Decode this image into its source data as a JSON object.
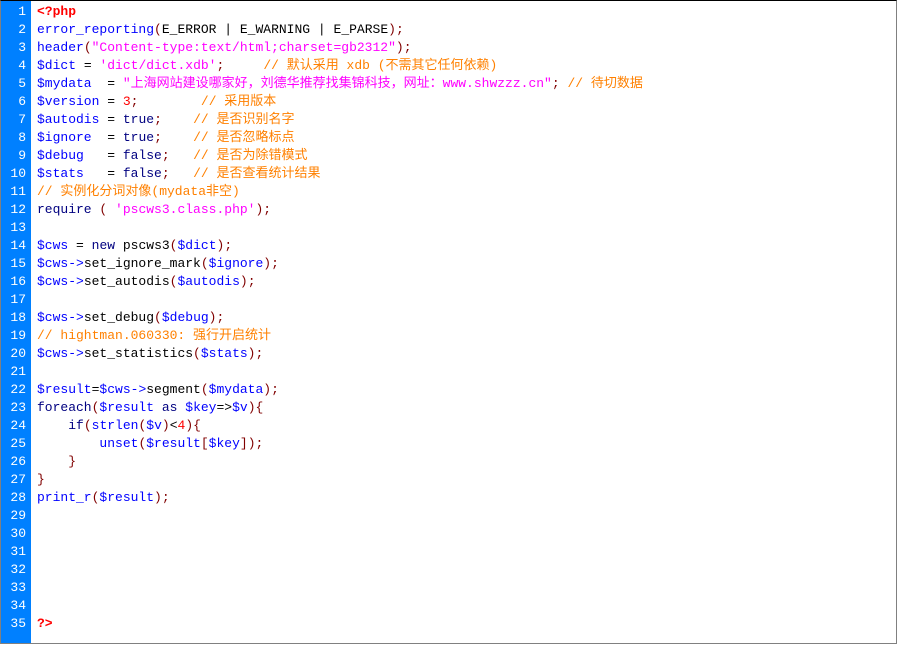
{
  "lines": [
    {
      "n": 1,
      "tokens": [
        [
          "php-tag",
          "<?php"
        ]
      ]
    },
    {
      "n": 2,
      "tokens": [
        [
          "func",
          "error_reporting"
        ],
        [
          "paren",
          "("
        ],
        [
          "id",
          "E_ERROR "
        ],
        [
          "op",
          "|"
        ],
        [
          "id",
          " E_WARNING "
        ],
        [
          "op",
          "|"
        ],
        [
          "id",
          " E_PARSE"
        ],
        [
          "paren",
          ")"
        ],
        [
          "semi",
          ";"
        ]
      ]
    },
    {
      "n": 3,
      "tokens": [
        [
          "func",
          "header"
        ],
        [
          "paren",
          "("
        ],
        [
          "str",
          "\"Content-type:text/html;charset=gb2312\""
        ],
        [
          "paren",
          ")"
        ],
        [
          "semi",
          ";"
        ]
      ]
    },
    {
      "n": 4,
      "tokens": [
        [
          "var",
          "$dict"
        ],
        [
          "id",
          " "
        ],
        [
          "op",
          "="
        ],
        [
          "id",
          " "
        ],
        [
          "str",
          "'dict/dict.xdb'"
        ],
        [
          "semi",
          ";"
        ],
        [
          "id",
          "     "
        ],
        [
          "cmt",
          "// 默认采用 xdb (不需其它任何依赖)"
        ]
      ]
    },
    {
      "n": 5,
      "tokens": [
        [
          "var",
          "$mydata"
        ],
        [
          "id",
          "  "
        ],
        [
          "op",
          "="
        ],
        [
          "id",
          " "
        ],
        [
          "str",
          "\"上海网站建设哪家好，刘德华推荐找集锦科技，网址：www.shwzzz.cn\""
        ],
        [
          "semi",
          ";"
        ],
        [
          "id",
          " "
        ],
        [
          "cmt",
          "// 待切数据"
        ]
      ]
    },
    {
      "n": 6,
      "tokens": [
        [
          "var",
          "$version"
        ],
        [
          "id",
          " "
        ],
        [
          "op",
          "="
        ],
        [
          "id",
          " "
        ],
        [
          "num",
          "3"
        ],
        [
          "semi",
          ";"
        ],
        [
          "id",
          "        "
        ],
        [
          "cmt",
          "// 采用版本"
        ]
      ]
    },
    {
      "n": 7,
      "tokens": [
        [
          "var",
          "$autodis"
        ],
        [
          "id",
          " "
        ],
        [
          "op",
          "="
        ],
        [
          "id",
          " "
        ],
        [
          "bool",
          "true"
        ],
        [
          "semi",
          ";"
        ],
        [
          "id",
          "    "
        ],
        [
          "cmt",
          "// 是否识别名字"
        ]
      ]
    },
    {
      "n": 8,
      "tokens": [
        [
          "var",
          "$ignore"
        ],
        [
          "id",
          "  "
        ],
        [
          "op",
          "="
        ],
        [
          "id",
          " "
        ],
        [
          "bool",
          "true"
        ],
        [
          "semi",
          ";"
        ],
        [
          "id",
          "    "
        ],
        [
          "cmt",
          "// 是否忽略标点"
        ]
      ]
    },
    {
      "n": 9,
      "tokens": [
        [
          "var",
          "$debug"
        ],
        [
          "id",
          "   "
        ],
        [
          "op",
          "="
        ],
        [
          "id",
          " "
        ],
        [
          "bool",
          "false"
        ],
        [
          "semi",
          ";"
        ],
        [
          "id",
          "   "
        ],
        [
          "cmt",
          "// 是否为除错模式"
        ]
      ]
    },
    {
      "n": 10,
      "tokens": [
        [
          "var",
          "$stats"
        ],
        [
          "id",
          "   "
        ],
        [
          "op",
          "="
        ],
        [
          "id",
          " "
        ],
        [
          "bool",
          "false"
        ],
        [
          "semi",
          ";"
        ],
        [
          "id",
          "   "
        ],
        [
          "cmt",
          "// 是否查看统计结果"
        ]
      ]
    },
    {
      "n": 11,
      "tokens": [
        [
          "cmt",
          "// 实例化分词对像(mydata非空)"
        ]
      ]
    },
    {
      "n": 12,
      "tokens": [
        [
          "kw",
          "require"
        ],
        [
          "id",
          " "
        ],
        [
          "paren",
          "("
        ],
        [
          "id",
          " "
        ],
        [
          "str",
          "'pscws3.class.php'"
        ],
        [
          "paren",
          ")"
        ],
        [
          "semi",
          ";"
        ]
      ]
    },
    {
      "n": 13,
      "tokens": []
    },
    {
      "n": 14,
      "tokens": [
        [
          "var",
          "$cws"
        ],
        [
          "id",
          " "
        ],
        [
          "op",
          "="
        ],
        [
          "id",
          " "
        ],
        [
          "kw",
          "new"
        ],
        [
          "id",
          " pscws3"
        ],
        [
          "paren",
          "("
        ],
        [
          "var",
          "$dict"
        ],
        [
          "paren",
          ")"
        ],
        [
          "semi",
          ";"
        ]
      ]
    },
    {
      "n": 15,
      "tokens": [
        [
          "var",
          "$cws"
        ],
        [
          "arrow",
          "->"
        ],
        [
          "id",
          "set_ignore_mark"
        ],
        [
          "paren",
          "("
        ],
        [
          "var",
          "$ignore"
        ],
        [
          "paren",
          ")"
        ],
        [
          "semi",
          ";"
        ]
      ]
    },
    {
      "n": 16,
      "tokens": [
        [
          "var",
          "$cws"
        ],
        [
          "arrow",
          "->"
        ],
        [
          "id",
          "set_autodis"
        ],
        [
          "paren",
          "("
        ],
        [
          "var",
          "$autodis"
        ],
        [
          "paren",
          ")"
        ],
        [
          "semi",
          ";"
        ]
      ]
    },
    {
      "n": 17,
      "tokens": []
    },
    {
      "n": 18,
      "tokens": [
        [
          "var",
          "$cws"
        ],
        [
          "arrow",
          "->"
        ],
        [
          "id",
          "set_debug"
        ],
        [
          "paren",
          "("
        ],
        [
          "var",
          "$debug"
        ],
        [
          "paren",
          ")"
        ],
        [
          "semi",
          ";"
        ]
      ]
    },
    {
      "n": 19,
      "tokens": [
        [
          "cmt",
          "// hightman.060330: 强行开启统计"
        ]
      ]
    },
    {
      "n": 20,
      "tokens": [
        [
          "var",
          "$cws"
        ],
        [
          "arrow",
          "->"
        ],
        [
          "id",
          "set_statistics"
        ],
        [
          "paren",
          "("
        ],
        [
          "var",
          "$stats"
        ],
        [
          "paren",
          ")"
        ],
        [
          "semi",
          ";"
        ]
      ]
    },
    {
      "n": 21,
      "tokens": []
    },
    {
      "n": 22,
      "tokens": [
        [
          "var",
          "$result"
        ],
        [
          "op",
          "="
        ],
        [
          "var",
          "$cws"
        ],
        [
          "arrow",
          "->"
        ],
        [
          "id",
          "segment"
        ],
        [
          "paren",
          "("
        ],
        [
          "var",
          "$mydata"
        ],
        [
          "paren",
          ")"
        ],
        [
          "semi",
          ";"
        ]
      ]
    },
    {
      "n": 23,
      "tokens": [
        [
          "kw",
          "foreach"
        ],
        [
          "paren",
          "("
        ],
        [
          "var",
          "$result"
        ],
        [
          "id",
          " "
        ],
        [
          "kw",
          "as"
        ],
        [
          "id",
          " "
        ],
        [
          "var",
          "$key"
        ],
        [
          "op",
          "=>"
        ],
        [
          "var",
          "$v"
        ],
        [
          "paren",
          ")"
        ],
        [
          "brace",
          "{"
        ]
      ]
    },
    {
      "n": 24,
      "tokens": [
        [
          "id",
          "    "
        ],
        [
          "kw",
          "if"
        ],
        [
          "paren",
          "("
        ],
        [
          "func",
          "strlen"
        ],
        [
          "paren",
          "("
        ],
        [
          "var",
          "$v"
        ],
        [
          "paren",
          ")"
        ],
        [
          "op",
          "<"
        ],
        [
          "num",
          "4"
        ],
        [
          "paren",
          ")"
        ],
        [
          "brace",
          "{"
        ]
      ]
    },
    {
      "n": 25,
      "tokens": [
        [
          "id",
          "        "
        ],
        [
          "func",
          "unset"
        ],
        [
          "paren",
          "("
        ],
        [
          "var",
          "$result"
        ],
        [
          "paren",
          "["
        ],
        [
          "var",
          "$key"
        ],
        [
          "paren",
          "]"
        ],
        [
          "paren",
          ")"
        ],
        [
          "semi",
          ";"
        ]
      ]
    },
    {
      "n": 26,
      "tokens": [
        [
          "id",
          "    "
        ],
        [
          "brace",
          "}"
        ]
      ]
    },
    {
      "n": 27,
      "tokens": [
        [
          "brace",
          "}"
        ]
      ]
    },
    {
      "n": 28,
      "tokens": [
        [
          "func",
          "print_r"
        ],
        [
          "paren",
          "("
        ],
        [
          "var",
          "$result"
        ],
        [
          "paren",
          ")"
        ],
        [
          "semi",
          ";"
        ]
      ]
    },
    {
      "n": 29,
      "tokens": []
    },
    {
      "n": 30,
      "tokens": []
    },
    {
      "n": 31,
      "tokens": []
    },
    {
      "n": 32,
      "tokens": []
    },
    {
      "n": 33,
      "tokens": []
    },
    {
      "n": 34,
      "tokens": []
    },
    {
      "n": 35,
      "tokens": [
        [
          "php-tag",
          "?>"
        ]
      ]
    }
  ]
}
